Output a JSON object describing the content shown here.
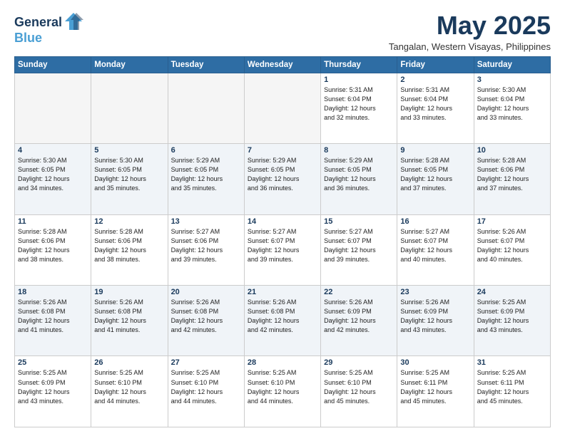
{
  "header": {
    "logo_line1": "General",
    "logo_line2": "Blue",
    "month_year": "May 2025",
    "location": "Tangalan, Western Visayas, Philippines"
  },
  "weekdays": [
    "Sunday",
    "Monday",
    "Tuesday",
    "Wednesday",
    "Thursday",
    "Friday",
    "Saturday"
  ],
  "weeks": [
    [
      {
        "day": "",
        "info": ""
      },
      {
        "day": "",
        "info": ""
      },
      {
        "day": "",
        "info": ""
      },
      {
        "day": "",
        "info": ""
      },
      {
        "day": "1",
        "info": "Sunrise: 5:31 AM\nSunset: 6:04 PM\nDaylight: 12 hours\nand 32 minutes."
      },
      {
        "day": "2",
        "info": "Sunrise: 5:31 AM\nSunset: 6:04 PM\nDaylight: 12 hours\nand 33 minutes."
      },
      {
        "day": "3",
        "info": "Sunrise: 5:30 AM\nSunset: 6:04 PM\nDaylight: 12 hours\nand 33 minutes."
      }
    ],
    [
      {
        "day": "4",
        "info": "Sunrise: 5:30 AM\nSunset: 6:05 PM\nDaylight: 12 hours\nand 34 minutes."
      },
      {
        "day": "5",
        "info": "Sunrise: 5:30 AM\nSunset: 6:05 PM\nDaylight: 12 hours\nand 35 minutes."
      },
      {
        "day": "6",
        "info": "Sunrise: 5:29 AM\nSunset: 6:05 PM\nDaylight: 12 hours\nand 35 minutes."
      },
      {
        "day": "7",
        "info": "Sunrise: 5:29 AM\nSunset: 6:05 PM\nDaylight: 12 hours\nand 36 minutes."
      },
      {
        "day": "8",
        "info": "Sunrise: 5:29 AM\nSunset: 6:05 PM\nDaylight: 12 hours\nand 36 minutes."
      },
      {
        "day": "9",
        "info": "Sunrise: 5:28 AM\nSunset: 6:05 PM\nDaylight: 12 hours\nand 37 minutes."
      },
      {
        "day": "10",
        "info": "Sunrise: 5:28 AM\nSunset: 6:06 PM\nDaylight: 12 hours\nand 37 minutes."
      }
    ],
    [
      {
        "day": "11",
        "info": "Sunrise: 5:28 AM\nSunset: 6:06 PM\nDaylight: 12 hours\nand 38 minutes."
      },
      {
        "day": "12",
        "info": "Sunrise: 5:28 AM\nSunset: 6:06 PM\nDaylight: 12 hours\nand 38 minutes."
      },
      {
        "day": "13",
        "info": "Sunrise: 5:27 AM\nSunset: 6:06 PM\nDaylight: 12 hours\nand 39 minutes."
      },
      {
        "day": "14",
        "info": "Sunrise: 5:27 AM\nSunset: 6:07 PM\nDaylight: 12 hours\nand 39 minutes."
      },
      {
        "day": "15",
        "info": "Sunrise: 5:27 AM\nSunset: 6:07 PM\nDaylight: 12 hours\nand 39 minutes."
      },
      {
        "day": "16",
        "info": "Sunrise: 5:27 AM\nSunset: 6:07 PM\nDaylight: 12 hours\nand 40 minutes."
      },
      {
        "day": "17",
        "info": "Sunrise: 5:26 AM\nSunset: 6:07 PM\nDaylight: 12 hours\nand 40 minutes."
      }
    ],
    [
      {
        "day": "18",
        "info": "Sunrise: 5:26 AM\nSunset: 6:08 PM\nDaylight: 12 hours\nand 41 minutes."
      },
      {
        "day": "19",
        "info": "Sunrise: 5:26 AM\nSunset: 6:08 PM\nDaylight: 12 hours\nand 41 minutes."
      },
      {
        "day": "20",
        "info": "Sunrise: 5:26 AM\nSunset: 6:08 PM\nDaylight: 12 hours\nand 42 minutes."
      },
      {
        "day": "21",
        "info": "Sunrise: 5:26 AM\nSunset: 6:08 PM\nDaylight: 12 hours\nand 42 minutes."
      },
      {
        "day": "22",
        "info": "Sunrise: 5:26 AM\nSunset: 6:09 PM\nDaylight: 12 hours\nand 42 minutes."
      },
      {
        "day": "23",
        "info": "Sunrise: 5:26 AM\nSunset: 6:09 PM\nDaylight: 12 hours\nand 43 minutes."
      },
      {
        "day": "24",
        "info": "Sunrise: 5:25 AM\nSunset: 6:09 PM\nDaylight: 12 hours\nand 43 minutes."
      }
    ],
    [
      {
        "day": "25",
        "info": "Sunrise: 5:25 AM\nSunset: 6:09 PM\nDaylight: 12 hours\nand 43 minutes."
      },
      {
        "day": "26",
        "info": "Sunrise: 5:25 AM\nSunset: 6:10 PM\nDaylight: 12 hours\nand 44 minutes."
      },
      {
        "day": "27",
        "info": "Sunrise: 5:25 AM\nSunset: 6:10 PM\nDaylight: 12 hours\nand 44 minutes."
      },
      {
        "day": "28",
        "info": "Sunrise: 5:25 AM\nSunset: 6:10 PM\nDaylight: 12 hours\nand 44 minutes."
      },
      {
        "day": "29",
        "info": "Sunrise: 5:25 AM\nSunset: 6:10 PM\nDaylight: 12 hours\nand 45 minutes."
      },
      {
        "day": "30",
        "info": "Sunrise: 5:25 AM\nSunset: 6:11 PM\nDaylight: 12 hours\nand 45 minutes."
      },
      {
        "day": "31",
        "info": "Sunrise: 5:25 AM\nSunset: 6:11 PM\nDaylight: 12 hours\nand 45 minutes."
      }
    ]
  ]
}
